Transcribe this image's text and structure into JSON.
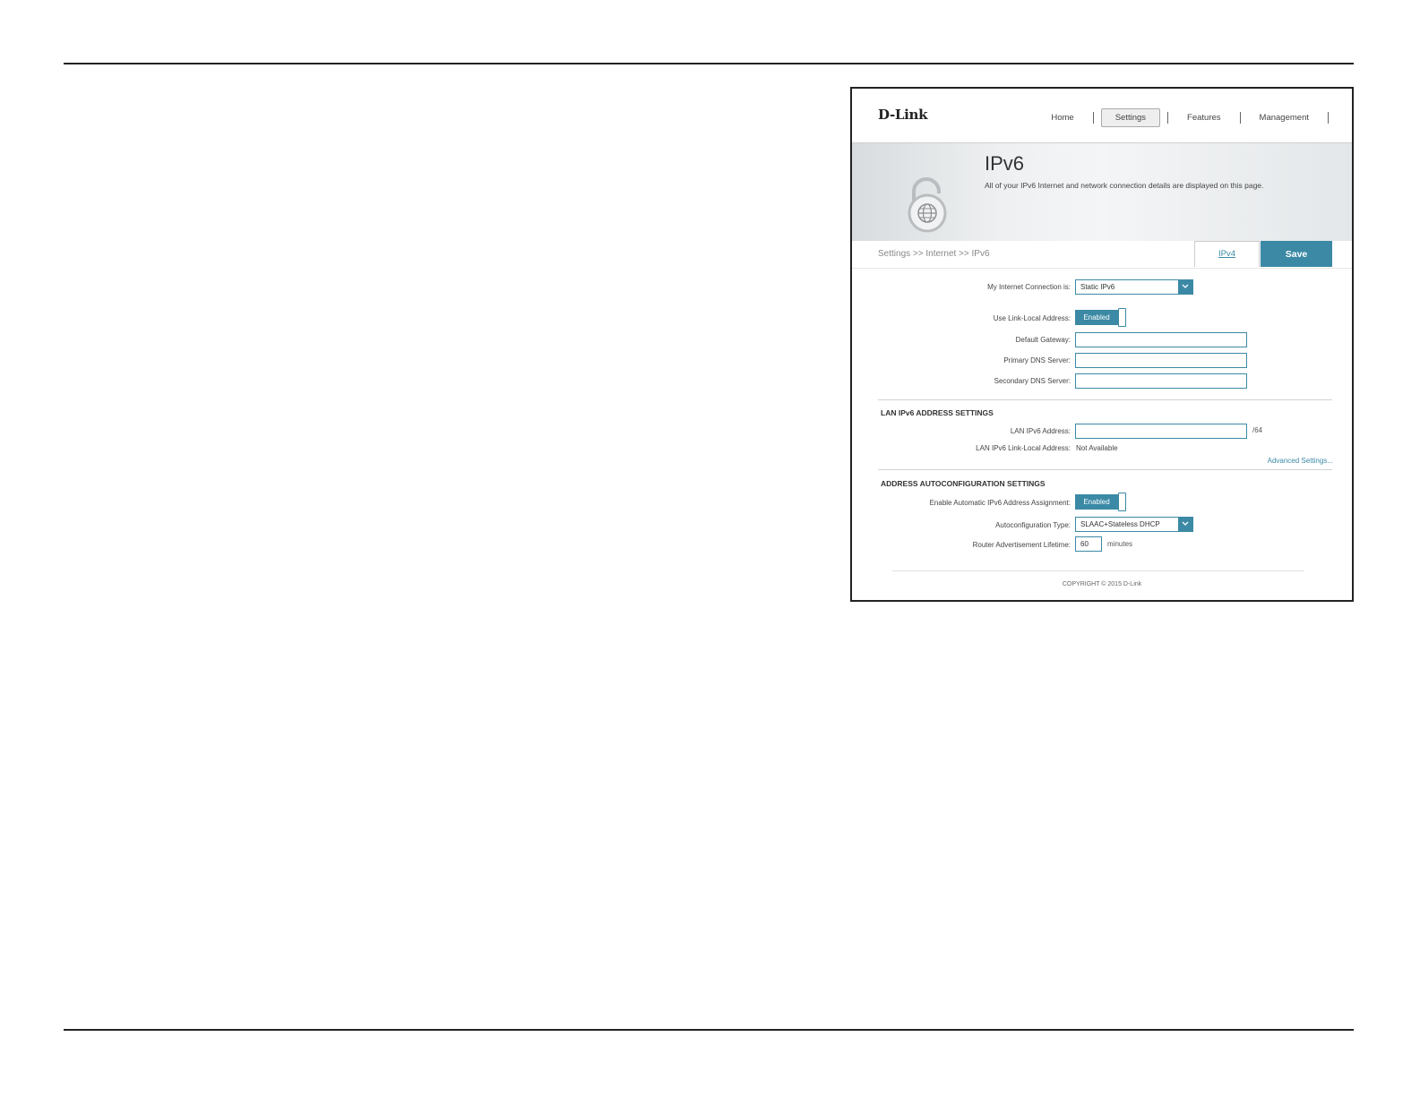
{
  "brand": {
    "logo_text": "D-Link"
  },
  "nav": {
    "home": "Home",
    "settings": "Settings",
    "features": "Features",
    "management": "Management"
  },
  "banner": {
    "title": "IPv6",
    "description": "All of your IPv6 Internet and network connection details are displayed on this page."
  },
  "breadcrumb": "Settings >> Internet >> IPv6",
  "tabs": {
    "ipv4": "IPv4",
    "save": "Save"
  },
  "form": {
    "connection": {
      "label": "My Internet Connection is:",
      "value": "Static IPv6"
    },
    "link_local": {
      "label": "Use Link-Local Address:",
      "state": "Enabled"
    },
    "default_gateway": {
      "label": "Default Gateway:",
      "value": ""
    },
    "primary_dns": {
      "label": "Primary DNS Server:",
      "value": ""
    },
    "secondary_dns": {
      "label": "Secondary DNS Server:",
      "value": ""
    }
  },
  "lan": {
    "title": "LAN IPv6 ADDRESS SETTINGS",
    "address": {
      "label": "LAN IPv6 Address:",
      "value": "",
      "suffix": "/64"
    },
    "link_local": {
      "label": "LAN IPv6 Link-Local Address:",
      "value": "Not Available"
    },
    "advanced": "Advanced Settings..."
  },
  "autoconf": {
    "title": "ADDRESS AUTOCONFIGURATION SETTINGS",
    "enable": {
      "label": "Enable Automatic IPv6 Address Assignment:",
      "state": "Enabled"
    },
    "type": {
      "label": "Autoconfiguration Type:",
      "value": "SLAAC+Stateless DHCP"
    },
    "lifetime": {
      "label": "Router Advertisement Lifetime:",
      "value": "60",
      "unit": "minutes"
    }
  },
  "footer": {
    "copyright": "COPYRIGHT © 2015 D-Link"
  },
  "colors": {
    "accent": "#3b89a5"
  }
}
